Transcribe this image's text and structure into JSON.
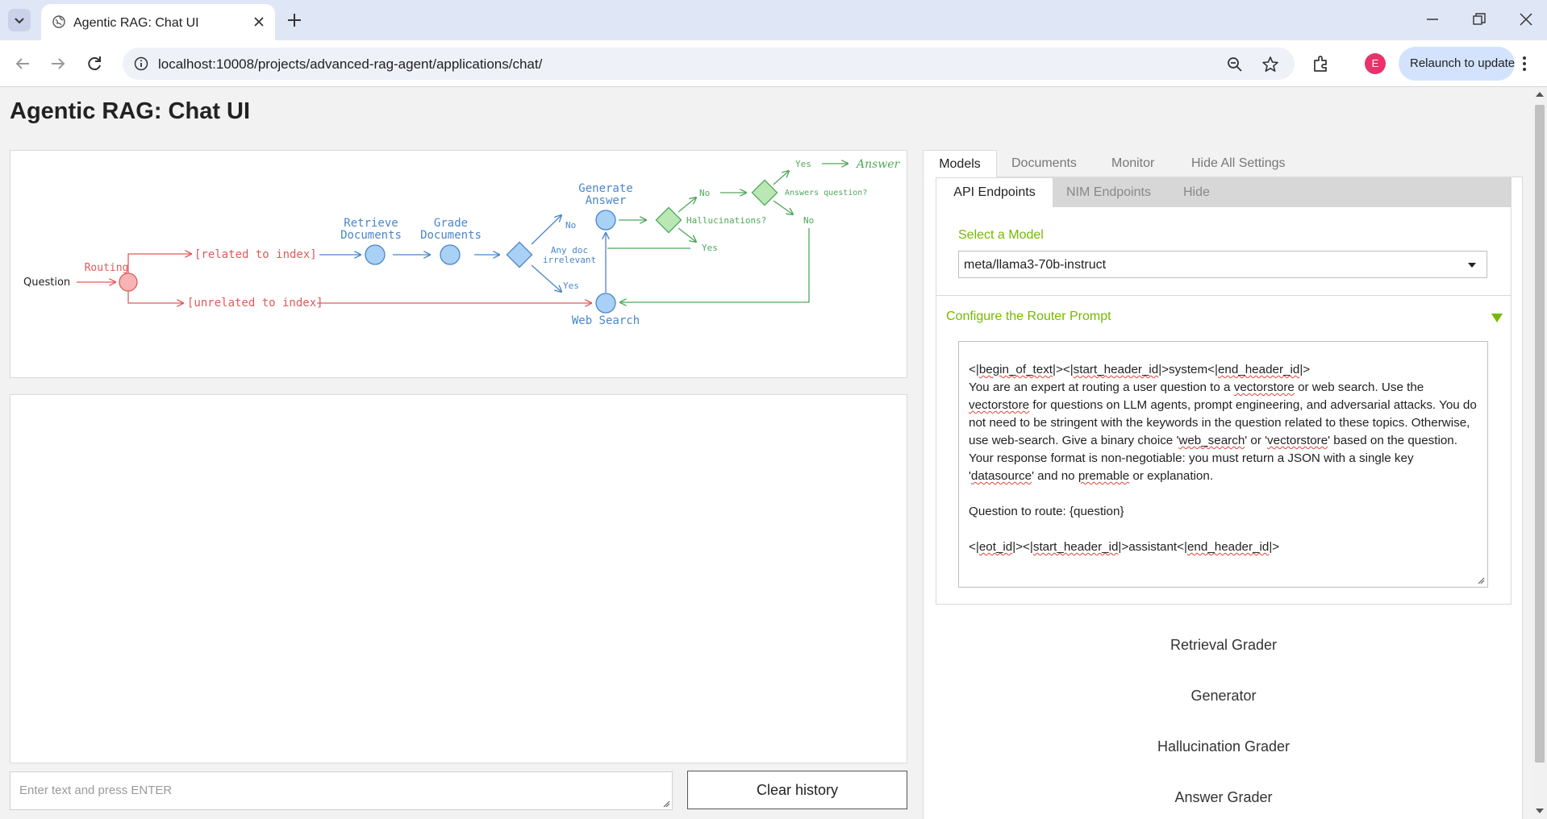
{
  "browser": {
    "tab_title": "Agentic RAG: Chat UI",
    "url": "localhost:10008/projects/advanced-rag-agent/applications/chat/",
    "profile_initial": "E",
    "relaunch_label": "Relaunch to update"
  },
  "app": {
    "title": "Agentic RAG: Chat UI"
  },
  "diagram": {
    "question": "Question",
    "routing": "Routing",
    "related": "[related to index]",
    "unrelated": "[unrelated to index]",
    "retrieve_1": "Retrieve",
    "retrieve_2": "Documents",
    "grade_1": "Grade",
    "grade_2": "Documents",
    "generate_1": "Generate",
    "generate_2": "Answer",
    "any_doc_1": "Any doc",
    "any_doc_2": "irrelevant",
    "no_1": "No",
    "yes_1": "Yes",
    "web_search": "Web Search",
    "no_2": "No",
    "hallucinations": "Hallucinations?",
    "yes_2": "Yes",
    "yes_3": "Yes",
    "answer": "Answer",
    "answers_question": "Answers question?",
    "no_3": "No"
  },
  "chat": {
    "input_placeholder": "Enter text and press ENTER",
    "clear_label": "Clear history"
  },
  "settings": {
    "tabs": [
      "Models",
      "Documents",
      "Monitor",
      "Hide All Settings"
    ],
    "sub_tabs": [
      "API Endpoints",
      "NIM Endpoints",
      "Hide"
    ],
    "model_label": "Select a Model",
    "model_value": "meta/llama3-70b-instruct",
    "router_header": "Configure the Router Prompt",
    "prompt": {
      "p1_a": "<|",
      "p1_b": "begin_of_text",
      "p1_c": "|><|",
      "p1_d": "start_header_id",
      "p1_e": "|>system<|",
      "p1_f": "end_header_id",
      "p1_g": "|>",
      "p2_a": "You are an expert at routing a user question to a ",
      "p2_b": "vectorstore",
      "p2_c": " or web search. Use the ",
      "p2_d": "vectorstore",
      "p2_e": " for questions on LLM agents, prompt engineering, and adversarial attacks. You do not need to be stringent with the keywords in the question related to these topics. Otherwise, use web-search. Give a binary choice '",
      "p2_f": "web_search",
      "p2_g": "' or '",
      "p2_h": "vectorstore",
      "p2_i": "' based on the question. Your response format is non-negotiable: you must return a JSON with a single key '",
      "p2_j": "datasource",
      "p2_k": "' and no ",
      "p2_l": "premable",
      "p2_m": " or explanation.",
      "p3": "Question to route: {question}",
      "p4_a": "<|",
      "p4_b": "eot_id",
      "p4_c": "|><|",
      "p4_d": "start_header_id",
      "p4_e": "|>assistant<|",
      "p4_f": "end_header_id",
      "p4_g": "|>"
    },
    "sections": [
      "Retrieval Grader",
      "Generator",
      "Hallucination Grader",
      "Answer Grader"
    ]
  },
  "colors": {
    "accent_green": "#76b900",
    "diagram_red": "#e05a5a",
    "diagram_blue": "#4a86c8",
    "diagram_green": "#4fa85a"
  }
}
